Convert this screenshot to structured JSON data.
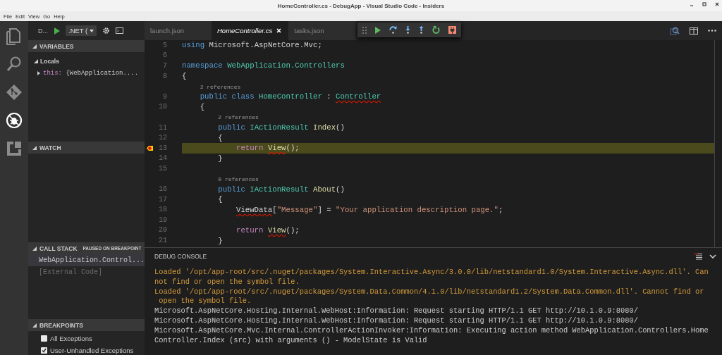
{
  "window": {
    "title": "HomeController.cs - DebugApp - Visual Studio Code - Insiders"
  },
  "menu": [
    "File",
    "Edit",
    "View",
    "Go",
    "Help"
  ],
  "activity_bar": [
    {
      "kind": "files",
      "selected": false
    },
    {
      "kind": "search",
      "selected": false
    },
    {
      "kind": "git",
      "selected": false
    },
    {
      "kind": "debug",
      "selected": true
    },
    {
      "kind": "extensions",
      "selected": false
    }
  ],
  "debug_header": {
    "title": "D...",
    "configuration": ".NET ("
  },
  "variables": {
    "title": "VARIABLES",
    "expanded": true,
    "items": [
      {
        "label": "Locals",
        "expanded": true,
        "children": [
          {
            "name": "this:",
            "value": "{WebApplication....",
            "expanded": false
          }
        ]
      }
    ]
  },
  "watch": {
    "title": "WATCH",
    "expanded": true
  },
  "call_stack": {
    "title": "CALL STACK",
    "expanded": true,
    "status": "PAUSED ON BREAKPOINT",
    "frames": [
      {
        "label": "WebApplication.Control...",
        "kind": "frame",
        "selected": true
      },
      {
        "label": "[External Code]",
        "kind": "external",
        "selected": false
      }
    ]
  },
  "breakpoints": {
    "title": "BREAKPOINTS",
    "expanded": true,
    "items": [
      {
        "label": "All Exceptions",
        "checked": false
      },
      {
        "label": "User-Unhandled Exceptions",
        "checked": true
      }
    ]
  },
  "tabs": [
    {
      "label": "launch.json",
      "selected": false
    },
    {
      "label": "HomeController.cs",
      "selected": true
    },
    {
      "label": "tasks.json",
      "selected": false
    }
  ],
  "editor": {
    "lines": [
      {
        "number": "5",
        "tokens": [
          {
            "text": "using",
            "kind": "keyword"
          },
          {
            "text": " Microsoft.AspNetCore.Mvc;",
            "kind": "plain"
          }
        ]
      },
      {
        "number": "6"
      },
      {
        "number": "7",
        "tokens": [
          {
            "text": "namespace ",
            "kind": "keyword"
          },
          {
            "text": "WebApplication.Controllers",
            "kind": "type"
          }
        ]
      },
      {
        "number": "8",
        "tokens": [
          {
            "text": "{",
            "kind": "plain"
          }
        ]
      },
      {
        "kind": "codelens",
        "text": "    2 references"
      },
      {
        "number": "9",
        "tokens": [
          {
            "text": "    public class ",
            "kind": "keyword"
          },
          {
            "text": "HomeController",
            "kind": "type"
          },
          {
            "text": " : ",
            "kind": "plain"
          },
          {
            "text": "Controller",
            "kind": "type",
            "squiggle": true
          }
        ]
      },
      {
        "number": "10",
        "tokens": [
          {
            "text": "    {",
            "kind": "plain"
          }
        ]
      },
      {
        "kind": "codelens",
        "text": "        2 references"
      },
      {
        "number": "11",
        "tokens": [
          {
            "text": "        public ",
            "kind": "keyword"
          },
          {
            "text": "IActionResult ",
            "kind": "type"
          },
          {
            "text": "Index",
            "kind": "function"
          },
          {
            "text": "()",
            "kind": "plain"
          }
        ]
      },
      {
        "number": "12",
        "tokens": [
          {
            "text": "        {",
            "kind": "plain"
          }
        ]
      },
      {
        "number": "13",
        "current": true,
        "breakpoint": true,
        "tokens": [
          {
            "text": "            return ",
            "kind": "control"
          },
          {
            "text": "View",
            "kind": "function",
            "squiggle": true
          },
          {
            "text": "();",
            "kind": "plain"
          }
        ]
      },
      {
        "number": "14",
        "tokens": [
          {
            "text": "        }",
            "kind": "plain"
          }
        ]
      },
      {
        "number": "15"
      },
      {
        "kind": "codelens",
        "text": "        0 references"
      },
      {
        "number": "16",
        "tokens": [
          {
            "text": "        public ",
            "kind": "keyword"
          },
          {
            "text": "IActionResult ",
            "kind": "type"
          },
          {
            "text": "About",
            "kind": "function"
          },
          {
            "text": "()",
            "kind": "plain"
          }
        ]
      },
      {
        "number": "17",
        "tokens": [
          {
            "text": "        {",
            "kind": "plain"
          }
        ]
      },
      {
        "number": "18",
        "tokens": [
          {
            "text": "            ViewData",
            "kind": "plain",
            "squiggle": true
          },
          {
            "text": "[",
            "kind": "plain"
          },
          {
            "text": "\"Message\"",
            "kind": "string"
          },
          {
            "text": "] = ",
            "kind": "plain"
          },
          {
            "text": "\"Your application description page.\"",
            "kind": "string"
          },
          {
            "text": ";",
            "kind": "plain"
          }
        ]
      },
      {
        "number": "19"
      },
      {
        "number": "20",
        "tokens": [
          {
            "text": "            return ",
            "kind": "control"
          },
          {
            "text": "View",
            "kind": "function",
            "squiggle": true
          },
          {
            "text": "();",
            "kind": "plain"
          }
        ]
      },
      {
        "number": "21",
        "tokens": [
          {
            "text": "        }",
            "kind": "plain"
          }
        ]
      }
    ]
  },
  "panel": {
    "title": "DEBUG CONSOLE",
    "lines": [
      {
        "kind": "warning",
        "text": "Loaded '/opt/app-root/src/.nuget/packages/System.Interactive.Async/3.0.0/lib/netstandard1.0/System.Interactive.Async.dll'. Can"
      },
      {
        "kind": "warning",
        "text": "not find or open the symbol file."
      },
      {
        "kind": "warning",
        "text": "Loaded '/opt/app-root/src/.nuget/packages/System.Data.Common/4.1.0/lib/netstandard1.2/System.Data.Common.dll'. Cannot find or"
      },
      {
        "kind": "warning",
        "text": " open the symbol file."
      },
      {
        "kind": "info",
        "text": "Microsoft.AspNetCore.Hosting.Internal.WebHost:Information: Request starting HTTP/1.1 GET http://10.1.0.9:8080/"
      },
      {
        "kind": "info",
        "text": "Microsoft.AspNetCore.Hosting.Internal.WebHost:Information: Request starting HTTP/1.1 GET http://10.1.0.9:8080/"
      },
      {
        "kind": "info",
        "text": "Microsoft.AspNetCore.Mvc.Internal.ControllerActionInvoker:Information: Executing action method WebApplication.Controllers.Home"
      },
      {
        "kind": "info",
        "text": "Controller.Index (src) with arguments () - ModelState is Valid"
      }
    ]
  }
}
